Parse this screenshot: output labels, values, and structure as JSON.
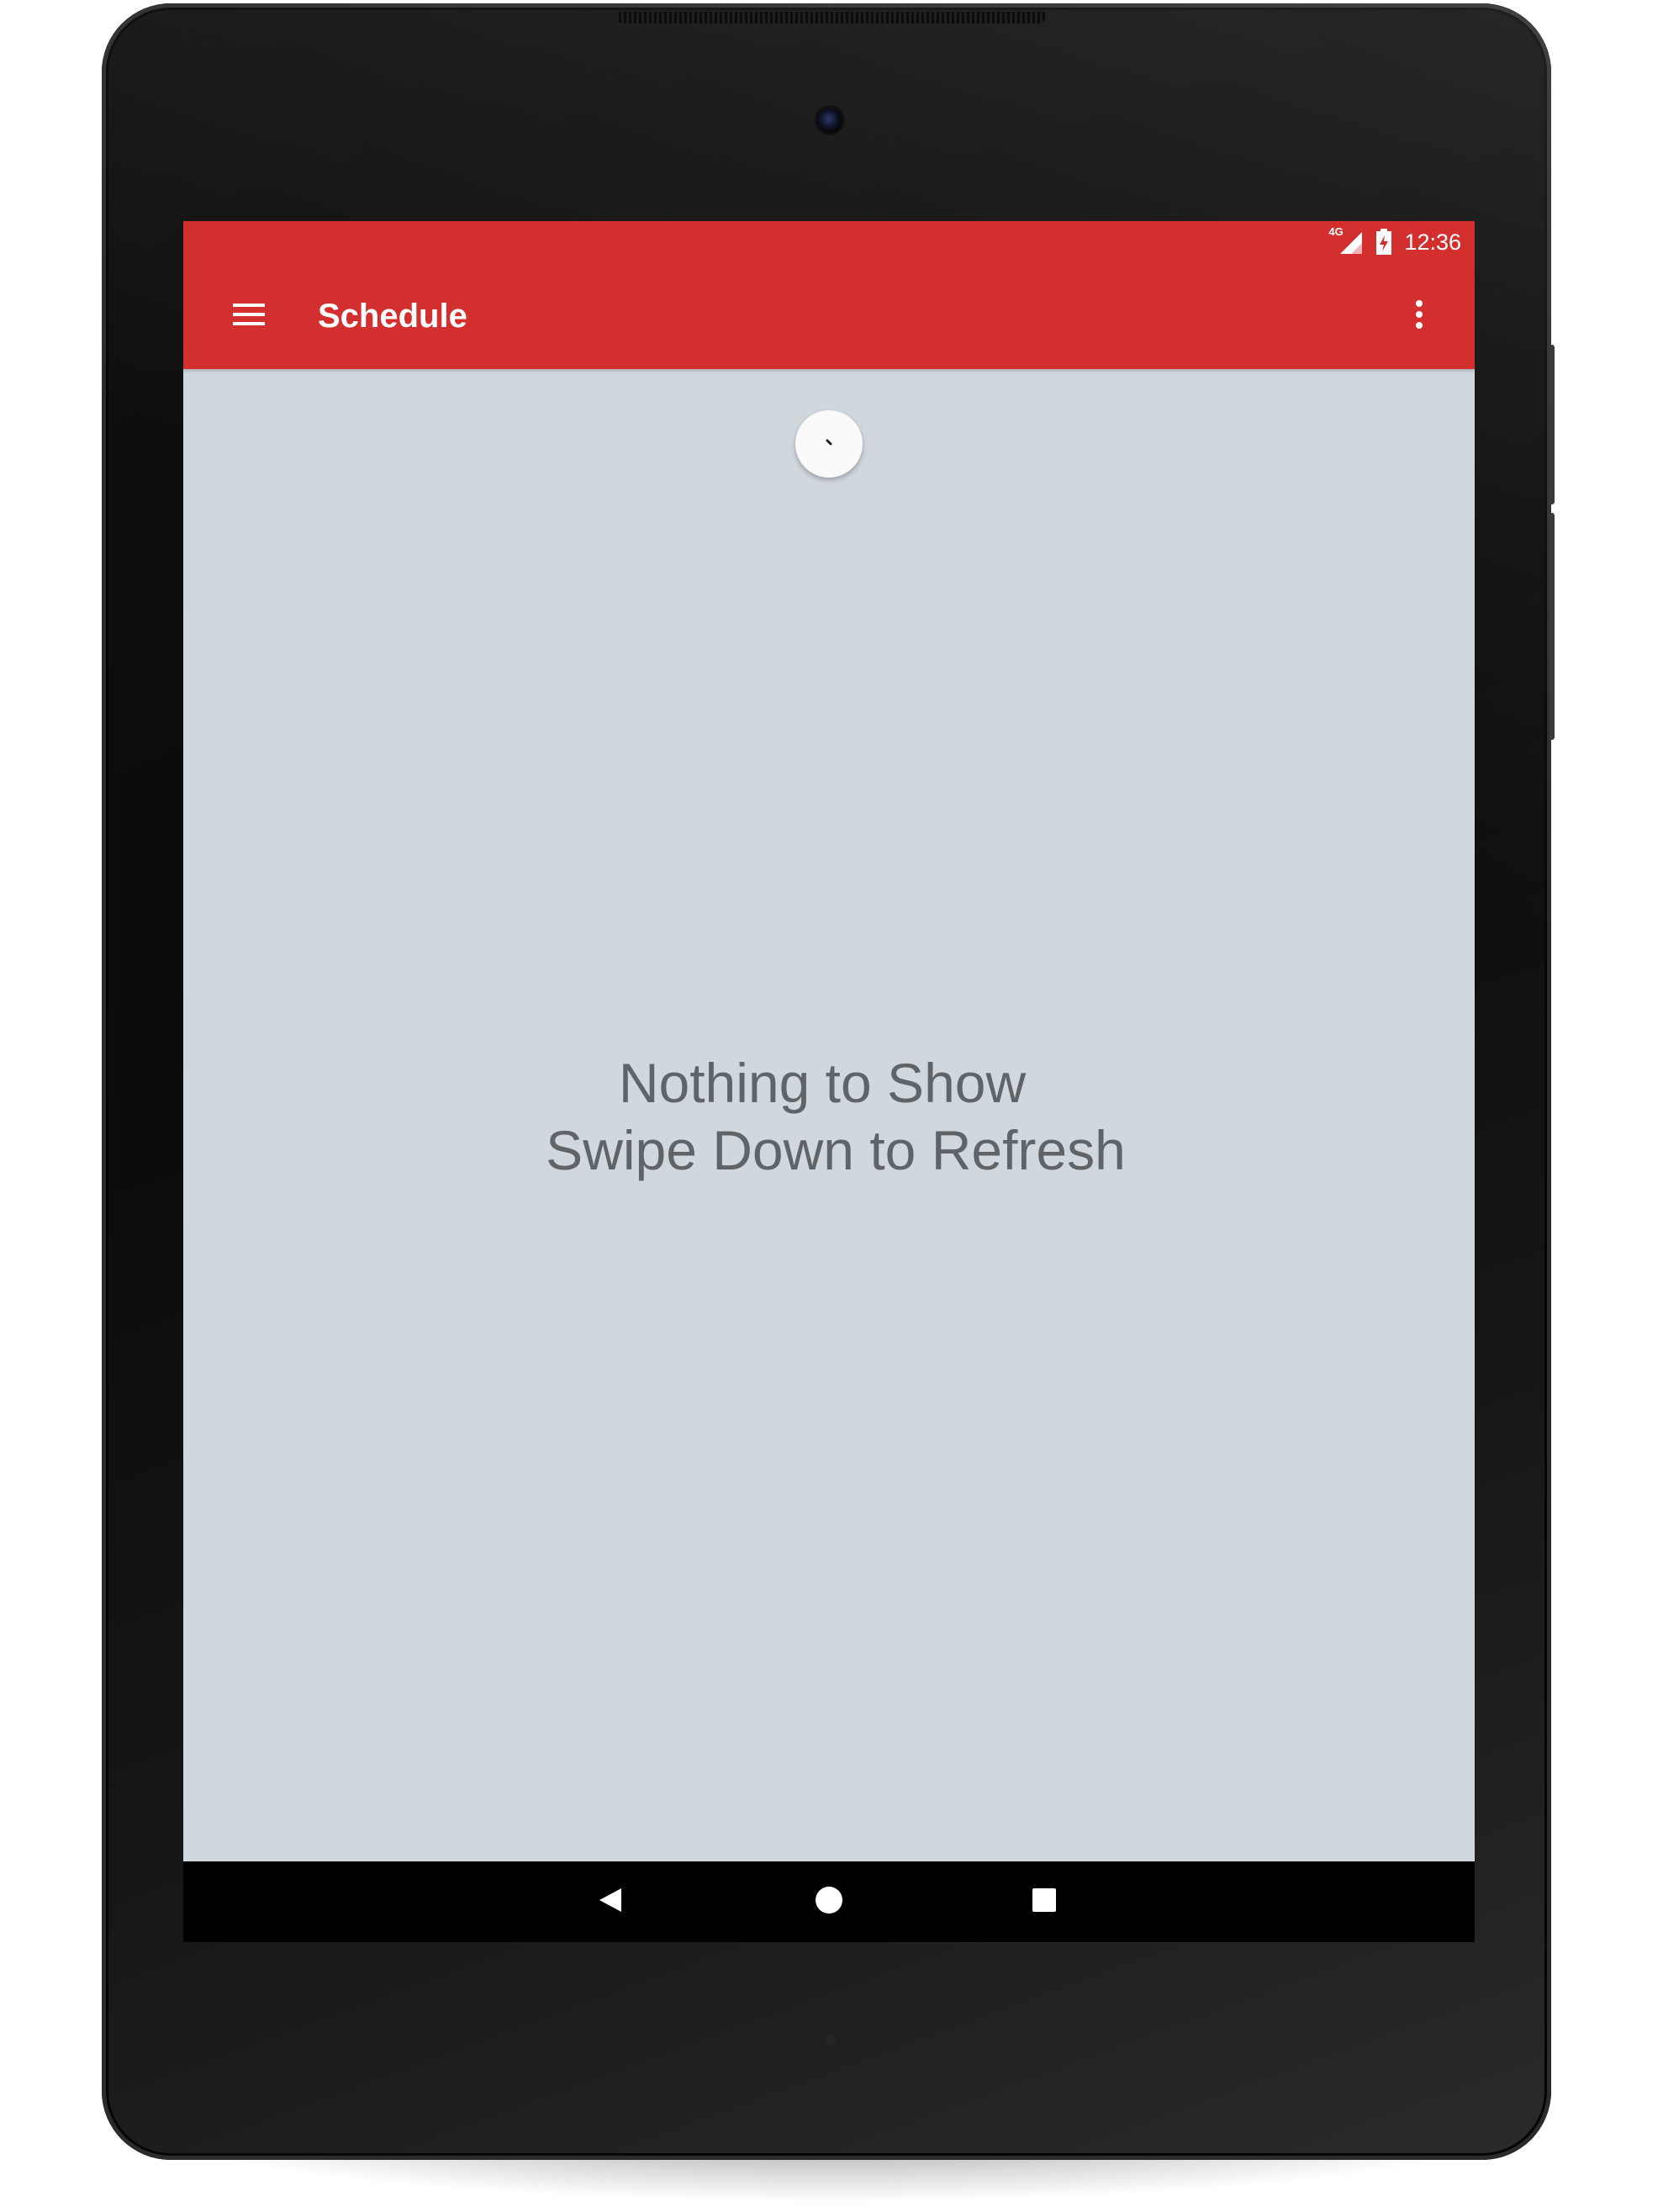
{
  "status_bar": {
    "network_label": "4G",
    "time": "12:36",
    "signal_icon": "cell-signal-icon",
    "battery_icon": "battery-charging-icon"
  },
  "app_bar": {
    "title": "Schedule",
    "menu_icon": "hamburger-menu-icon",
    "overflow_icon": "more-vert-icon",
    "color": "#d32f2f"
  },
  "content": {
    "background": "#d0d7dd",
    "empty_line1": "Nothing to Show",
    "empty_line2": "Swipe Down to Refresh",
    "refresh_icon": "pull-to-refresh-spinner-icon"
  },
  "nav_bar": {
    "back_icon": "back-triangle-icon",
    "home_icon": "home-circle-icon",
    "recents_icon": "recents-square-icon"
  }
}
